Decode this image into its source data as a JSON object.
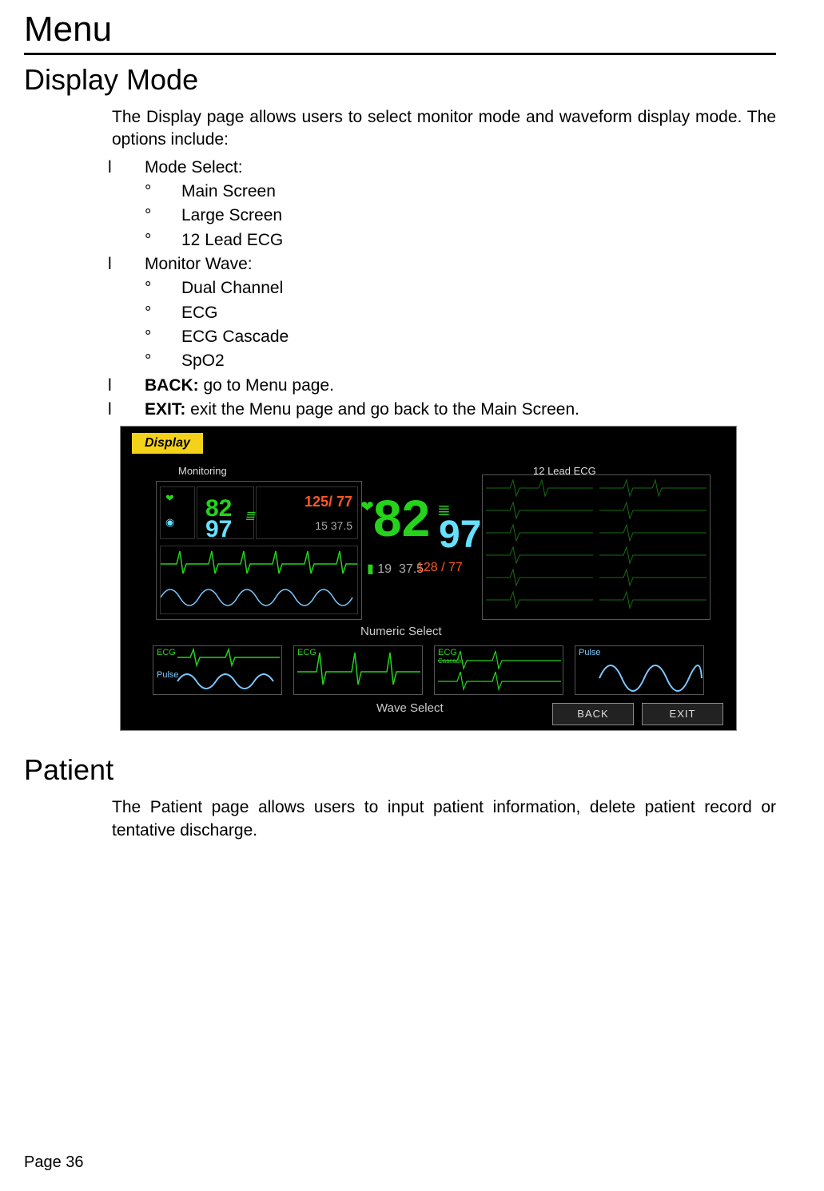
{
  "chapter": "Menu",
  "sections": {
    "display_mode": {
      "heading": "Display Mode",
      "intro": "The Display page allows users to select monitor mode and waveform display mode. The options include:",
      "mode_select_label": "Mode Select:",
      "mode_select_items": [
        "Main Screen",
        "Large Screen",
        "12 Lead ECG"
      ],
      "monitor_wave_label": "Monitor Wave:",
      "monitor_wave_items": [
        "Dual Channel",
        "ECG",
        "ECG Cascade",
        "SpO2"
      ],
      "back_label": "BACK:",
      "back_desc": " go to Menu page.",
      "exit_label": "EXIT:",
      "exit_desc": " exit the Menu page and go back to the Main Screen."
    },
    "patient": {
      "heading": "Patient",
      "intro": "The Patient page allows users to input patient information, delete patient record or tentative discharge."
    }
  },
  "screenshot": {
    "tab": "Display",
    "monitoring_label": "Monitoring",
    "lead_ecg_label": "12 Lead ECG",
    "numeric_select_label": "Numeric  Select",
    "wave_select_label": "Wave Select",
    "back_btn": "BACK",
    "exit_btn": "EXIT",
    "mini": {
      "hr": "82",
      "spo2": "97",
      "bp": "125/ 77",
      "temp_rr": "15   37.5"
    },
    "big": {
      "hr": "82",
      "spo2": "97",
      "temp": "37.5",
      "bp": "128 / 77",
      "rr": "19"
    },
    "tiles": [
      {
        "top_label": "ECG",
        "top_color": "green",
        "bottom_label": "Pulse",
        "bottom_color": "blue"
      },
      {
        "top_label": "ECG",
        "top_color": "green"
      },
      {
        "top_label": "ECG",
        "top_color": "green",
        "sub": "Cascade"
      },
      {
        "top_label": "Pulse",
        "top_color": "blue"
      }
    ]
  },
  "page_number": "Page 36"
}
